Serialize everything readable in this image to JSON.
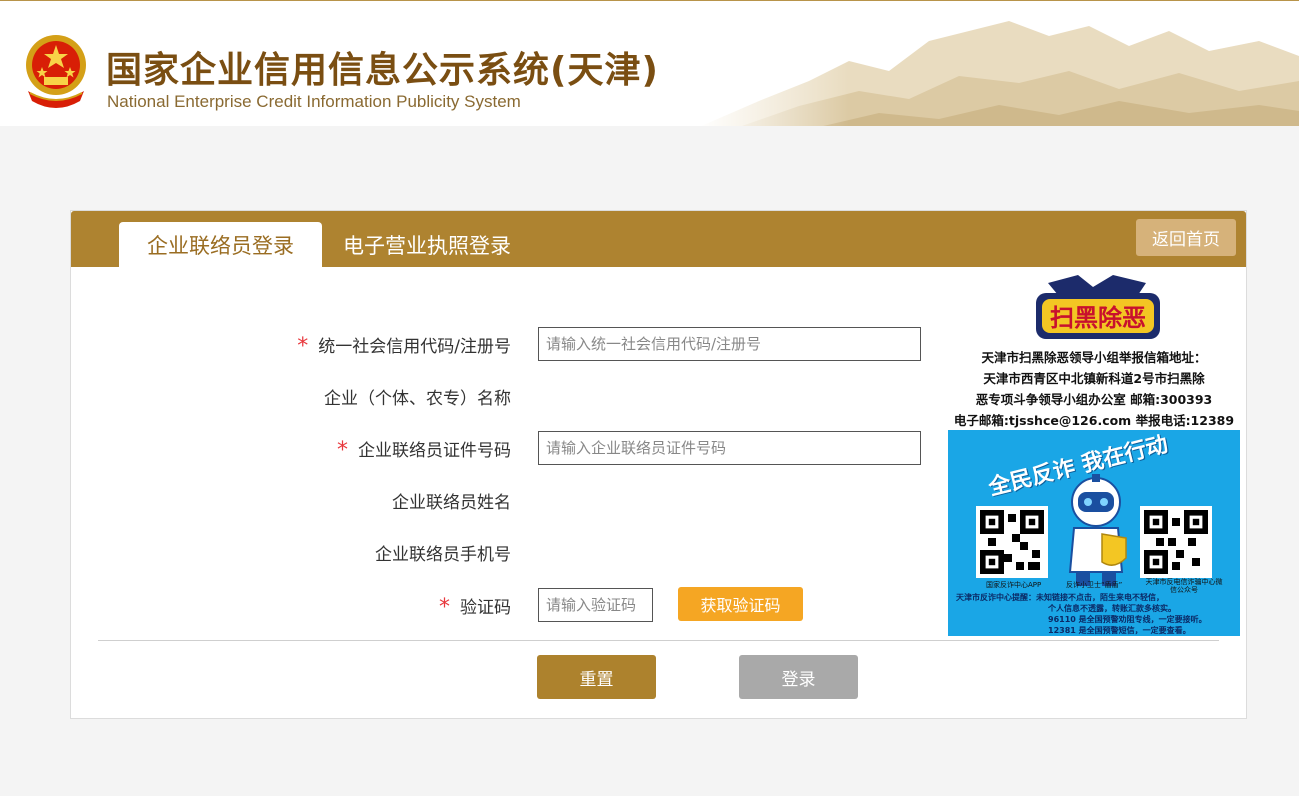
{
  "header": {
    "title_cn": "国家企业信用信息公示系统(天津)",
    "title_en": "National Enterprise Credit Information Publicity System"
  },
  "tabs": {
    "active": "企业联络员登录",
    "inactive": "电子营业执照登录"
  },
  "home_button": "返回首页",
  "form": {
    "credit_code": {
      "label": "统一社会信用代码/注册号",
      "placeholder": "请输入统一社会信用代码/注册号",
      "required": true
    },
    "company_name": {
      "label": "企业（个体、农专）名称",
      "required": false
    },
    "contact_id": {
      "label": "企业联络员证件号码",
      "placeholder": "请输入企业联络员证件号码",
      "required": true
    },
    "contact_name": {
      "label": "企业联络员姓名",
      "required": false
    },
    "contact_phone": {
      "label": "企业联络员手机号",
      "required": false
    },
    "verify_code": {
      "label": "验证码",
      "placeholder": "请输入验证码",
      "required": true
    },
    "get_code_button": "获取验证码",
    "required_mark": "*"
  },
  "actions": {
    "reset": "重置",
    "login": "登录"
  },
  "ad_sweep": {
    "logo_text": "扫黑除恶",
    "lines": [
      "天津市扫黑除恶领导小组举报信箱地址：",
      "天津市西青区中北镇新科道2号市扫黑除",
      "恶专项斗争领导小组办公室 邮箱:300393",
      "电子邮箱:tjsshce@126.com 举报电话:12389"
    ]
  },
  "ad_fraud": {
    "title": "全民反诈 我在行动",
    "caption_left": "国家反诈中心APP",
    "caption_mid": "反诈小卫士“盾盾”",
    "caption_right": "天津市反电信诈骗中心微信公众号",
    "foot_lines": [
      "天津市反诈中心提醒：未知链接不点击，陌生来电不轻信，",
      "个人信息不透露，转账汇款多核实。",
      "96110 是全国预警劝阻专线，一定要接听。",
      "12381 是全国预警短信，一定要查看。"
    ]
  },
  "colors": {
    "brand": "#ae8330",
    "title": "#7a4e12",
    "required": "#e8383d",
    "code_button": "#f5a623",
    "login_disabled": "#a9a9a9"
  }
}
